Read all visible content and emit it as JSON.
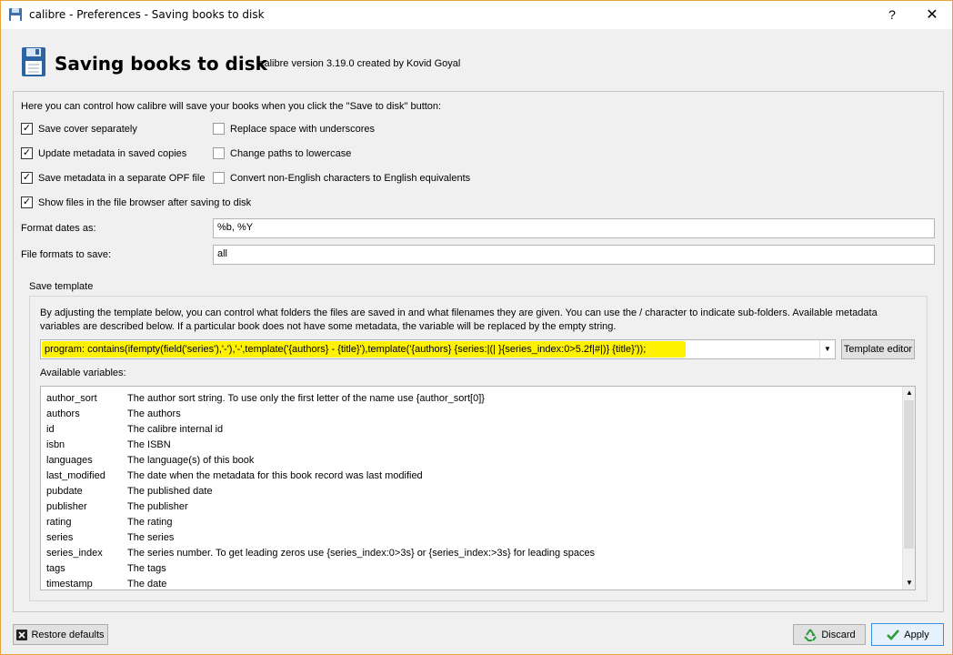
{
  "window": {
    "title": "calibre - Preferences - Saving books to disk",
    "help": "?",
    "close": "✕"
  },
  "header": {
    "title": "Saving books to disk",
    "subtitle": "calibre version 3.19.0 created by Kovid Goyal"
  },
  "intro": "Here you can control how calibre will save your books when you click the \"Save to disk\" button:",
  "options": {
    "save_cover": {
      "label": "Save cover separately",
      "checked": true
    },
    "update_metadata": {
      "label": "Update metadata in saved copies",
      "checked": true
    },
    "save_opf": {
      "label": "Save metadata in a separate OPF file",
      "checked": true
    },
    "show_files": {
      "label": "Show files in the file browser after saving to disk",
      "checked": true
    },
    "replace_space": {
      "label": "Replace space with underscores",
      "checked": false
    },
    "lowercase": {
      "label": "Change paths to lowercase",
      "checked": false
    },
    "ascii": {
      "label": "Convert non-English characters to English equivalents",
      "checked": false
    }
  },
  "format_dates": {
    "label": "Format dates as:",
    "value": "%b, %Y"
  },
  "file_formats": {
    "label": "File formats to save:",
    "value": "all"
  },
  "save_template": {
    "legend": "Save template",
    "description": "By adjusting the template below, you can control what folders the files are saved in and what filenames they are given. You can use the / character to indicate sub-folders. Available metadata variables are described below. If a particular book does not have some metadata, the variable will be replaced by the empty string.",
    "value": "program: contains(ifempty(field('series'),'-'),'-',template('{authors} - {title}'),template('{authors} {series:|(| }{series_index:0>5.2f|#|)} {title}'));",
    "editor_button": "Template editor",
    "available_label": "Available variables:",
    "variables": [
      {
        "name": "author_sort",
        "desc": "The author sort string. To use only the first letter of the name use {author_sort[0]}"
      },
      {
        "name": "authors",
        "desc": "The authors"
      },
      {
        "name": "id",
        "desc": "The calibre internal id"
      },
      {
        "name": "isbn",
        "desc": "The ISBN"
      },
      {
        "name": "languages",
        "desc": "The language(s) of this book"
      },
      {
        "name": "last_modified",
        "desc": "The date when the metadata for this book record was last modified"
      },
      {
        "name": "pubdate",
        "desc": "The published date"
      },
      {
        "name": "publisher",
        "desc": "The publisher"
      },
      {
        "name": "rating",
        "desc": "The rating"
      },
      {
        "name": "series",
        "desc": "The series"
      },
      {
        "name": "series_index",
        "desc": "The series number. To get leading zeros use {series_index:0>3s} or {series_index:>3s} for leading spaces"
      },
      {
        "name": "tags",
        "desc": "The tags"
      },
      {
        "name": "timestamp",
        "desc": "The date"
      }
    ]
  },
  "buttons": {
    "restore": "Restore defaults",
    "discard": "Discard",
    "apply": "Apply"
  },
  "colors": {
    "highlight": "#fff200",
    "accent_border": "#e8a33c",
    "apply_border": "#3c8fd8"
  },
  "icons": [
    "floppy-disk-icon",
    "help-icon",
    "close-icon",
    "chevron-down-icon",
    "restore-icon",
    "recycle-icon",
    "checkmark-icon"
  ]
}
